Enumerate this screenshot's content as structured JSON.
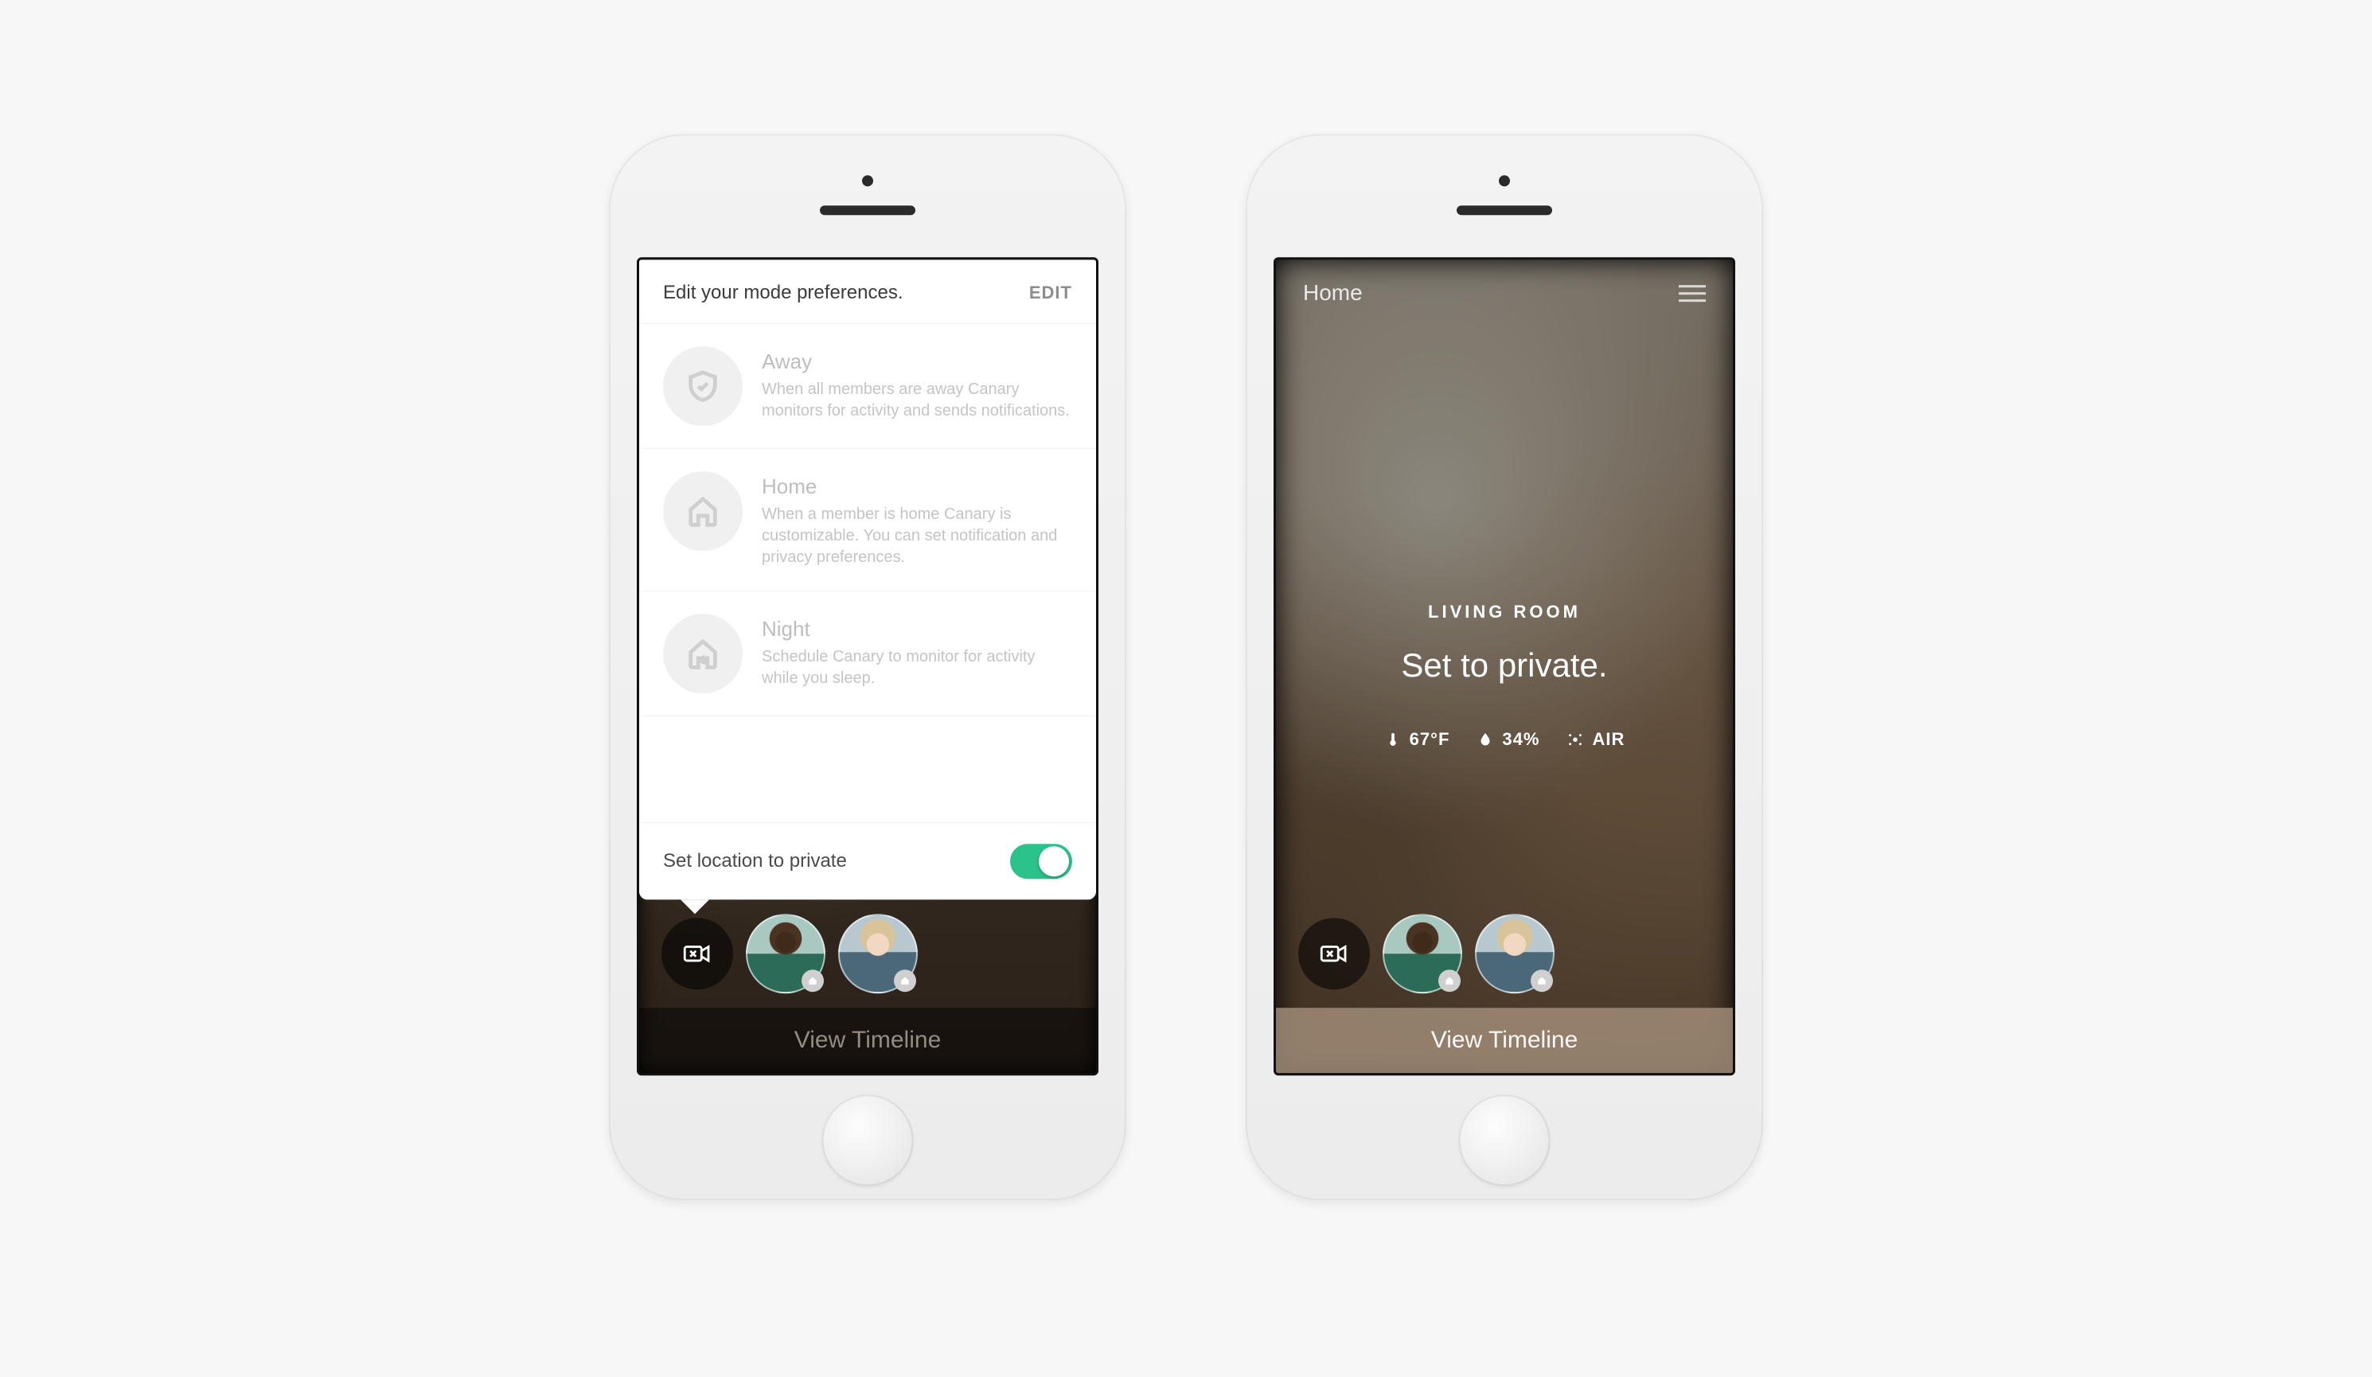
{
  "phoneA": {
    "popup": {
      "title": "Edit your mode preferences.",
      "edit": "EDIT",
      "modes": [
        {
          "name": "Away",
          "desc": "When all members are away Canary monitors for activity and sends notifications."
        },
        {
          "name": "Home",
          "desc": "When a member is home Canary is customizable. You can set notification and privacy preferences."
        },
        {
          "name": "Night",
          "desc": "Schedule Canary to monitor for activity while you sleep."
        }
      ],
      "private_label": "Set location to private",
      "private_on": true
    },
    "timeline": "View Timeline"
  },
  "phoneB": {
    "header": "Home",
    "room": "LIVING ROOM",
    "status": "Set to private.",
    "env": {
      "temp": "67°F",
      "humidity": "34%",
      "air": "AIR"
    },
    "timeline": "View Timeline"
  },
  "colors": {
    "toggle_on": "#2cc28c"
  }
}
